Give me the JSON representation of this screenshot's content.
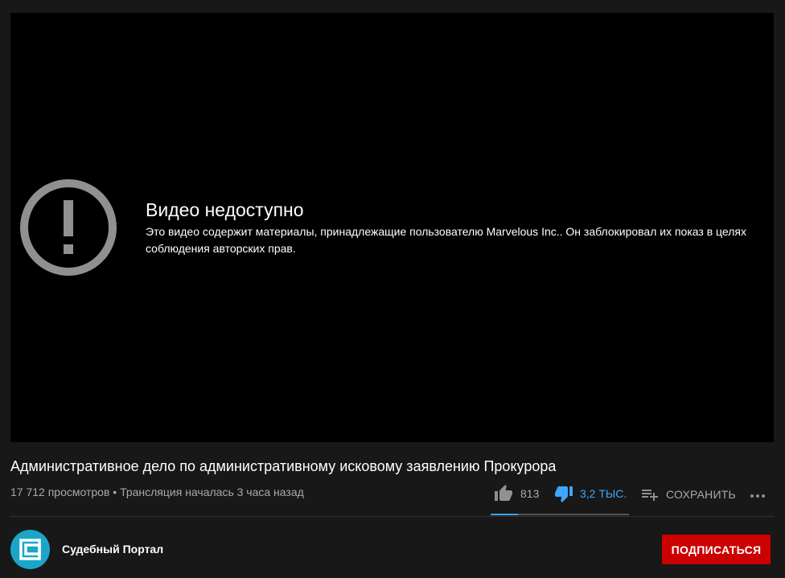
{
  "player": {
    "error_icon": "exclamation-circle-icon",
    "error_title": "Видео недоступно",
    "error_message": "Это видео содержит материалы, принадлежащие пользователю Marvelous Inc.. Он заблокировал их показ в целях соблюдения авторских прав."
  },
  "video": {
    "title": "Административное дело по административному исковому заявлению Прокурора",
    "meta": "17 712 просмотров • Трансляция началась 3 часа назад"
  },
  "actions": {
    "like_icon": "thumb-up-icon",
    "like_count": "813",
    "dislike_icon": "thumb-down-icon",
    "dislike_count": "3,2 ТЫС.",
    "save_icon": "playlist-add-icon",
    "save_label": "СОХРАНИТЬ",
    "more_icon": "more-horizontal-icon",
    "like_ratio": 0.2
  },
  "channel": {
    "name": "Судебный Портал",
    "avatar_color": "#1ba6c9",
    "subscribe_label": "ПОДПИСАТЬСЯ"
  },
  "colors": {
    "background": "#181818",
    "player": "#000000",
    "accent_blue": "#3ea6ff",
    "subscribe_red": "#cc0000",
    "muted_text": "#aaaaaa"
  }
}
